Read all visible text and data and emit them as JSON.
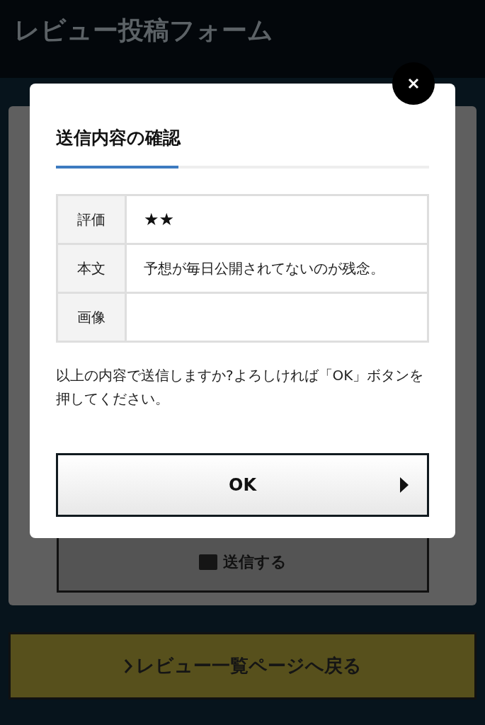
{
  "header": {
    "title": "レビュー投稿フォーム"
  },
  "form": {
    "submit_button": "送信する"
  },
  "back_button": "レビュー一覧ページへ戻る",
  "dialog": {
    "title": "送信内容の確認",
    "rows": [
      {
        "kind": "rating",
        "label": "評価",
        "value": "★★"
      },
      {
        "kind": "text",
        "label": "本文",
        "value": "予想が毎日公開されてないのが残念。"
      },
      {
        "kind": "image",
        "label": "画像"
      }
    ],
    "message": "以上の内容で送信しますか?よろしければ「OK」ボタンを押してください。",
    "ok_button": "OK"
  }
}
